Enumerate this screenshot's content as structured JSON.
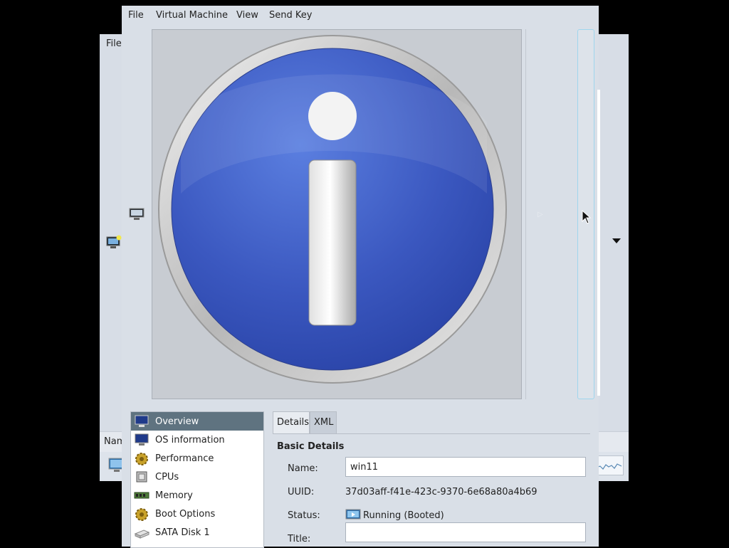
{
  "background_window": {
    "menu_file": "File",
    "list_header_name": "Nam"
  },
  "menubar": {
    "file": "File",
    "virtual_machine": "Virtual Machine",
    "view": "View",
    "send_key": "Send Key"
  },
  "console": {
    "displayed_image": "info-icon"
  },
  "nav": {
    "items": [
      {
        "label": "Overview",
        "icon": "monitor-icon",
        "selected": true
      },
      {
        "label": "OS information",
        "icon": "monitor-icon",
        "selected": false
      },
      {
        "label": "Performance",
        "icon": "gear-icon",
        "selected": false
      },
      {
        "label": "CPUs",
        "icon": "chip-icon",
        "selected": false
      },
      {
        "label": "Memory",
        "icon": "memory-icon",
        "selected": false
      },
      {
        "label": "Boot Options",
        "icon": "gear-icon",
        "selected": false
      },
      {
        "label": "SATA Disk 1",
        "icon": "disk-icon",
        "selected": false
      }
    ]
  },
  "tabs": {
    "details": "Details",
    "xml": "XML"
  },
  "details": {
    "section_title": "Basic Details",
    "name_label": "Name:",
    "name_value": "win11",
    "uuid_label": "UUID:",
    "uuid_value": "37d03aff-f41e-423c-9370-6e68a80a4b69",
    "status_label": "Status:",
    "status_value": "Running (Booted)",
    "title_label": "Title:",
    "title_value": ""
  },
  "colors": {
    "selection": "#5f7380",
    "window_bg": "#d9dfe7",
    "info_blue": "#3d5cc4"
  }
}
